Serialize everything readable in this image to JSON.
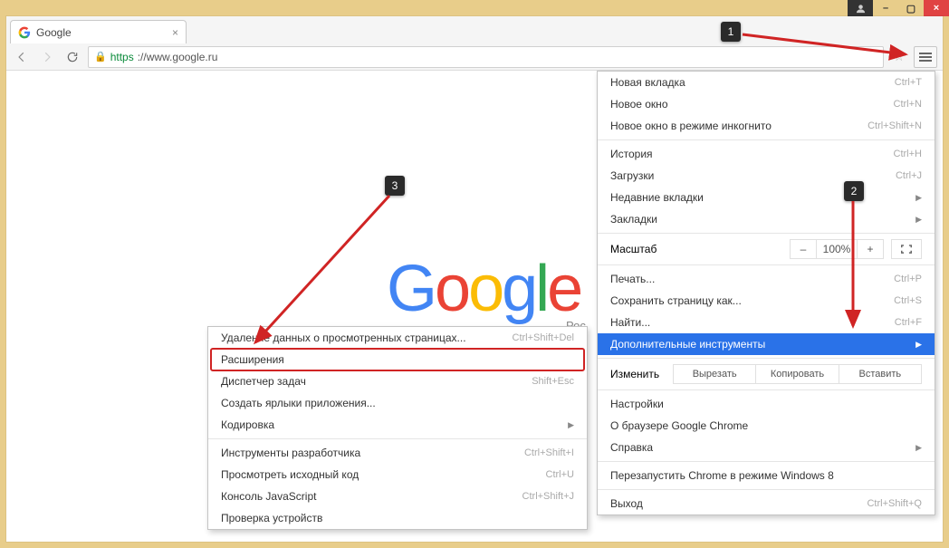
{
  "titlebar": {
    "user_icon": "▲",
    "minimize": "–",
    "maximize": "▢",
    "close": "×"
  },
  "tab": {
    "title": "Google"
  },
  "toolbar": {
    "back": "←",
    "forward": "→",
    "reload": "⟳",
    "url_https": "https",
    "url_rest": "://www.google.ru",
    "star": "☆"
  },
  "page": {
    "logo_g1": "G",
    "logo_o1": "o",
    "logo_o2": "o",
    "logo_g2": "g",
    "logo_l": "l",
    "logo_e": "e",
    "sub": "Рос"
  },
  "main_menu": {
    "new_tab": {
      "label": "Новая вкладка",
      "shortcut": "Ctrl+T"
    },
    "new_window": {
      "label": "Новое окно",
      "shortcut": "Ctrl+N"
    },
    "incognito": {
      "label": "Новое окно в режиме инкогнито",
      "shortcut": "Ctrl+Shift+N"
    },
    "history": {
      "label": "История",
      "shortcut": "Ctrl+H"
    },
    "downloads": {
      "label": "Загрузки",
      "shortcut": "Ctrl+J"
    },
    "recent_tabs": {
      "label": "Недавние вкладки"
    },
    "bookmarks": {
      "label": "Закладки"
    },
    "zoom_label": "Масштаб",
    "zoom_minus": "–",
    "zoom_value": "100%",
    "zoom_plus": "+",
    "zoom_full": "⛶",
    "print": {
      "label": "Печать...",
      "shortcut": "Ctrl+P"
    },
    "save_as": {
      "label": "Сохранить страницу как...",
      "shortcut": "Ctrl+S"
    },
    "find": {
      "label": "Найти...",
      "shortcut": "Ctrl+F"
    },
    "more_tools": {
      "label": "Дополнительные инструменты"
    },
    "edit_label": "Изменить",
    "cut": "Вырезать",
    "copy": "Копировать",
    "paste": "Вставить",
    "settings": {
      "label": "Настройки"
    },
    "about": {
      "label": "О браузере Google Chrome"
    },
    "help": {
      "label": "Справка"
    },
    "relaunch": {
      "label": "Перезапустить Chrome в режиме Windows 8"
    },
    "exit": {
      "label": "Выход",
      "shortcut": "Ctrl+Shift+Q"
    }
  },
  "sub_menu": {
    "clear_data": {
      "label": "Удаление данных о просмотренных страницах...",
      "shortcut": "Ctrl+Shift+Del"
    },
    "extensions": {
      "label": "Расширения"
    },
    "task_mgr": {
      "label": "Диспетчер задач",
      "shortcut": "Shift+Esc"
    },
    "shortcuts": {
      "label": "Создать ярлыки приложения..."
    },
    "encoding": {
      "label": "Кодировка"
    },
    "dev_tools": {
      "label": "Инструменты разработчика",
      "shortcut": "Ctrl+Shift+I"
    },
    "view_source": {
      "label": "Просмотреть исходный код",
      "shortcut": "Ctrl+U"
    },
    "js_console": {
      "label": "Консоль JavaScript",
      "shortcut": "Ctrl+Shift+J"
    },
    "inspect_dev": {
      "label": "Проверка устройств"
    }
  },
  "badges": {
    "b1": "1",
    "b2": "2",
    "b3": "3"
  }
}
